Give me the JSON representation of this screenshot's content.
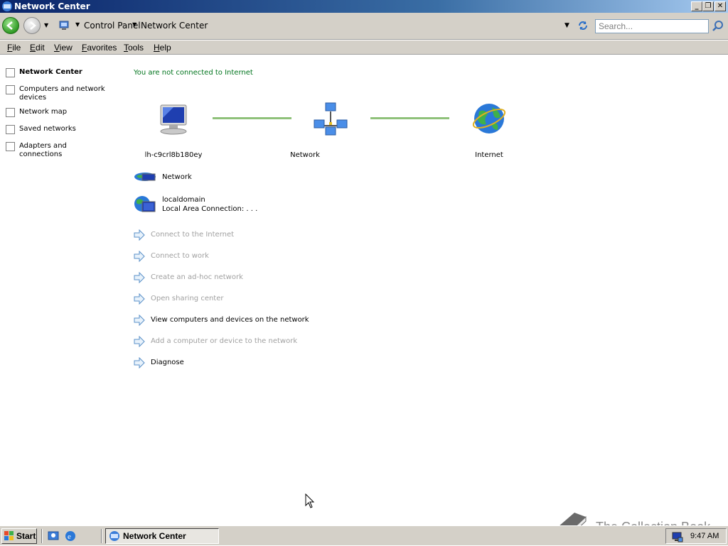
{
  "window": {
    "title": "Network Center",
    "controls": {
      "minimize": "_",
      "restore": "❐",
      "close": "✕"
    }
  },
  "addressbar": {
    "breadcrumbs": [
      "Control Panel",
      "Network Center"
    ],
    "search_placeholder": "Search..."
  },
  "menubar": {
    "items": [
      {
        "label": "File",
        "underline": "F",
        "rest": "ile"
      },
      {
        "label": "Edit",
        "underline": "E",
        "rest": "dit"
      },
      {
        "label": "View",
        "underline": "V",
        "rest": "iew"
      },
      {
        "label": "Favorites",
        "underline": "F",
        "rest": "avorites"
      },
      {
        "label": "Tools",
        "underline": "T",
        "rest": "ools"
      },
      {
        "label": "Help",
        "underline": "H",
        "rest": "elp"
      }
    ]
  },
  "sidebar": {
    "items": [
      {
        "label": "Network Center",
        "active": true
      },
      {
        "label": "Computers and network devices",
        "active": false
      },
      {
        "label": "Network map",
        "active": false
      },
      {
        "label": "Saved networks",
        "active": false
      },
      {
        "label": "Adapters and connections",
        "active": false
      }
    ]
  },
  "main": {
    "status": "You are not connected to Internet",
    "status_color": "#00741d",
    "diagram": {
      "computer_label": "lh-c9crl8b180ey",
      "network_label": "Network",
      "internet_label": "Internet",
      "link_color": "#8fc17a"
    },
    "networks": [
      {
        "name": "Network",
        "detail": ""
      },
      {
        "name": "localdomain",
        "detail": "Local Area Connection: . . ."
      }
    ],
    "tasks": [
      {
        "label": "Connect to the Internet",
        "enabled": false
      },
      {
        "label": "Connect to work",
        "enabled": false
      },
      {
        "label": "Create an ad-hoc network",
        "enabled": false
      },
      {
        "label": "Open sharing center",
        "enabled": false
      },
      {
        "label": "View computers and devices on the network",
        "enabled": true
      },
      {
        "label": "Add a computer or device to the network",
        "enabled": false
      },
      {
        "label": "Diagnose",
        "enabled": true
      }
    ]
  },
  "taskbar": {
    "start_label": "Start",
    "active_window": "Network Center",
    "clock": "9:47 AM"
  },
  "watermark": {
    "text": "The Collection Book"
  }
}
